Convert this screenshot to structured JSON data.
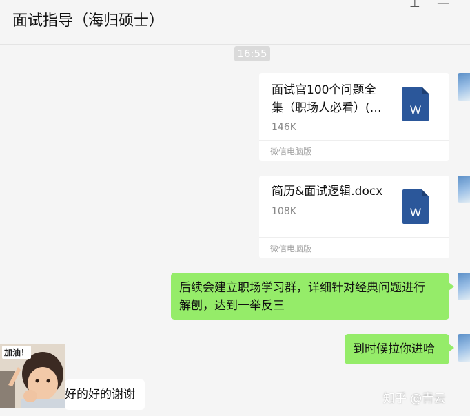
{
  "window": {
    "title": "面试指导（海归硕士）",
    "pin_glyph": "⊥",
    "minimize_glyph": "—"
  },
  "chat": {
    "timestamp": "16:55",
    "files": [
      {
        "name_line1": "面试官100个问题全",
        "name_line2": "集（职场人必看）(…",
        "size": "146K",
        "source": "微信电脑版",
        "icon_letter": "W"
      },
      {
        "name_line1": "简历&面试逻辑.docx",
        "name_line2": "",
        "size": "108K",
        "source": "微信电脑版",
        "icon_letter": "W"
      }
    ],
    "messages": [
      {
        "line1": "后续会建立职场学习群，详细针对经典问题进行",
        "line2": "解刨，达到一举反三"
      },
      {
        "line1": "到时候拉你进哈",
        "line2": ""
      }
    ],
    "sticker_text": "加油！",
    "reply": "好的好的谢谢"
  },
  "watermark": "知乎 @青云",
  "colors": {
    "bubble_green": "#95ec69",
    "word_blue": "#2b579a",
    "background": "#f5f5f5"
  }
}
